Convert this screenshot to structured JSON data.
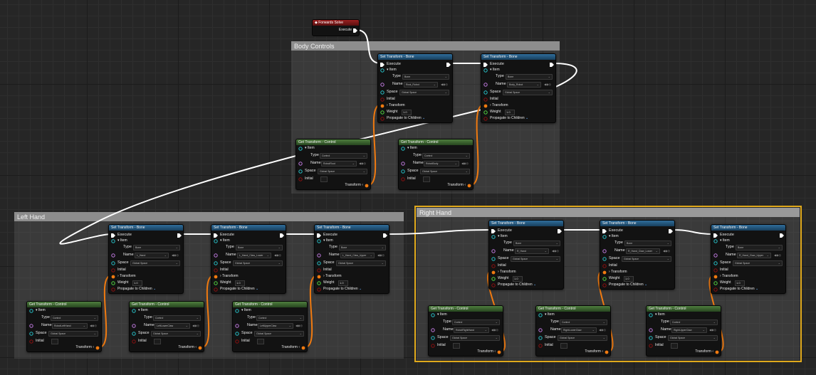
{
  "colors": {
    "bone_header": "#2f6d9a",
    "control_header": "#4e7d3e",
    "event_header": "#9a2020",
    "exec_wire": "#ffffff",
    "transform_wire": "#f07a10",
    "selected_outline": "#e0a91c"
  },
  "event_node": {
    "title": "Forwards Solve",
    "exec_label": "Execute"
  },
  "comments": {
    "body": "Body Controls",
    "left": "Left Hand",
    "right": "Right Hand"
  },
  "bone_nodes": [
    {
      "title": "Set Transform - Bone",
      "execute": "Execute",
      "item": "Item",
      "type_label": "Type",
      "type_value": "Bone",
      "name_label": "Name",
      "name_value": "Root_Robot",
      "space_label": "Space",
      "space_value": "Global Space",
      "initial": "Initial",
      "transform": "Transform",
      "weight_label": "Weight",
      "weight_value": "1.0",
      "propagate": "Propagate to Children"
    },
    {
      "title": "Set Transform - Bone",
      "execute": "Execute",
      "item": "Item",
      "type_label": "Type",
      "type_value": "Bone",
      "name_label": "Name",
      "name_value": "Body_Robot",
      "space_label": "Space",
      "space_value": "Global Space",
      "initial": "Initial",
      "transform": "Transform",
      "weight_label": "Weight",
      "weight_value": "1.0",
      "propagate": "Propagate to Children"
    },
    {
      "title": "Set Transform - Bone",
      "execute": "Execute",
      "item": "Item",
      "type_label": "Type",
      "type_value": "Bone",
      "name_label": "Name",
      "name_value": "L_Hand",
      "space_label": "Space",
      "space_value": "Global Space",
      "initial": "Initial",
      "transform": "Transform",
      "weight_label": "Weight",
      "weight_value": "1.0",
      "propagate": "Propagate to Children"
    },
    {
      "title": "Set Transform - Bone",
      "execute": "Execute",
      "item": "Item",
      "type_label": "Type",
      "type_value": "Bone",
      "name_label": "Name",
      "name_value": "L_Hand_Claw_Lower",
      "space_label": "Space",
      "space_value": "Global Space",
      "initial": "Initial",
      "transform": "Transform",
      "weight_label": "Weight",
      "weight_value": "1.0",
      "propagate": "Propagate to Children"
    },
    {
      "title": "Set Transform - Bone",
      "execute": "Execute",
      "item": "Item",
      "type_label": "Type",
      "type_value": "Bone",
      "name_label": "Name",
      "name_value": "L_Hand_Claw_Upper",
      "space_label": "Space",
      "space_value": "Global Space",
      "initial": "Initial",
      "transform": "Transform",
      "weight_label": "Weight",
      "weight_value": "1.0",
      "propagate": "Propagate to Children"
    },
    {
      "title": "Set Transform - Bone",
      "execute": "Execute",
      "item": "Item",
      "type_label": "Type",
      "type_value": "Bone",
      "name_label": "Name",
      "name_value": "R_Hand",
      "space_label": "Space",
      "space_value": "Global Space",
      "initial": "Initial",
      "transform": "Transform",
      "weight_label": "Weight",
      "weight_value": "1.0",
      "propagate": "Propagate to Children"
    },
    {
      "title": "Set Transform - Bone",
      "execute": "Execute",
      "item": "Item",
      "type_label": "Type",
      "type_value": "Bone",
      "name_label": "Name",
      "name_value": "R_Hand_Claw_Lower",
      "space_label": "Space",
      "space_value": "Global Space",
      "initial": "Initial",
      "transform": "Transform",
      "weight_label": "Weight",
      "weight_value": "1.0",
      "propagate": "Propagate to Children"
    },
    {
      "title": "Set Transform - Bone",
      "execute": "Execute",
      "item": "Item",
      "type_label": "Type",
      "type_value": "Bone",
      "name_label": "Name",
      "name_value": "R_Hand_Claw_Upper",
      "space_label": "Space",
      "space_value": "Global Space",
      "initial": "Initial",
      "transform": "Transform",
      "weight_label": "Weight",
      "weight_value": "1.0",
      "propagate": "Propagate to Children"
    }
  ],
  "control_nodes": [
    {
      "title": "Get Transform - Control",
      "item": "Item",
      "type_label": "Type",
      "type_value": "Control",
      "name_label": "Name",
      "name_value": "RobotRoot",
      "space_label": "Space",
      "space_value": "Global Space",
      "initial": "Initial",
      "transform": "Transform"
    },
    {
      "title": "Get Transform - Control",
      "item": "Item",
      "type_label": "Type",
      "type_value": "Control",
      "name_label": "Name",
      "name_value": "RobotBody",
      "space_label": "Space",
      "space_value": "Global Space",
      "initial": "Initial",
      "transform": "Transform"
    },
    {
      "title": "Get Transform - Control",
      "item": "Item",
      "type_label": "Type",
      "type_value": "Control",
      "name_label": "Name",
      "name_value": "RobotLeftHand",
      "space_label": "Space",
      "space_value": "Global Space",
      "initial": "Initial",
      "transform": "Transform"
    },
    {
      "title": "Get Transform - Control",
      "item": "Item",
      "type_label": "Type",
      "type_value": "Control",
      "name_label": "Name",
      "name_value": "LeftLowerClaw",
      "space_label": "Space",
      "space_value": "Global Space",
      "initial": "Initial",
      "transform": "Transform"
    },
    {
      "title": "Get Transform - Control",
      "item": "Item",
      "type_label": "Type",
      "type_value": "Control",
      "name_label": "Name",
      "name_value": "LeftUpperClaw",
      "space_label": "Space",
      "space_value": "Global Space",
      "initial": "Initial",
      "transform": "Transform"
    },
    {
      "title": "Get Transform - Control",
      "item": "Item",
      "type_label": "Type",
      "type_value": "Control",
      "name_label": "Name",
      "name_value": "RobotRightHand",
      "space_label": "Space",
      "space_value": "Global Space",
      "initial": "Initial",
      "transform": "Transform"
    },
    {
      "title": "Get Transform - Control",
      "item": "Item",
      "type_label": "Type",
      "type_value": "Control",
      "name_label": "Name",
      "name_value": "RightLowerClaw",
      "space_label": "Space",
      "space_value": "Global Space",
      "initial": "Initial",
      "transform": "Transform"
    },
    {
      "title": "Get Transform - Control",
      "item": "Item",
      "type_label": "Type",
      "type_value": "Control",
      "name_label": "Name",
      "name_value": "RightUpperClaw",
      "space_label": "Space",
      "space_value": "Global Space",
      "initial": "Initial",
      "transform": "Transform"
    }
  ]
}
